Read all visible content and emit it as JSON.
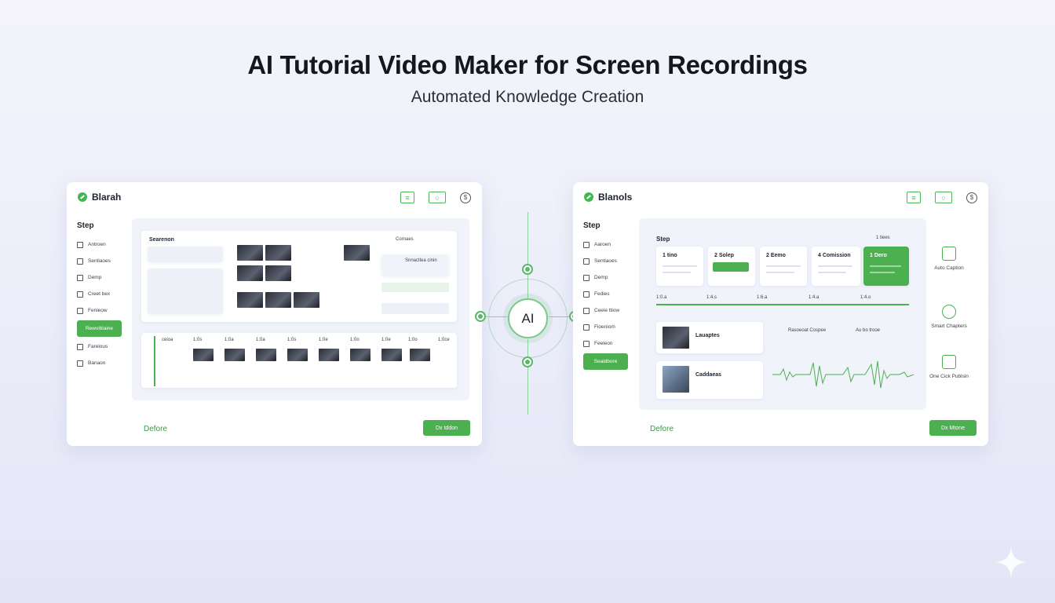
{
  "hero": {
    "title": "AI Tutorial Video Maker for Screen Recordings",
    "subtitle": "Automated Knowledge Creation"
  },
  "colors": {
    "accent": "#4caf50",
    "accent_light": "#8fd19b",
    "background": "#eceefa"
  },
  "left_panel": {
    "brand": "Blarah",
    "sidebar_title": "Step",
    "sidebar": [
      {
        "label": "Antroen",
        "icon": "calendar-icon"
      },
      {
        "label": "Sentiaoes",
        "icon": "grid-icon"
      },
      {
        "label": "Demp",
        "icon": "warning-icon"
      },
      {
        "label": "Creet bex",
        "icon": "doc-icon"
      },
      {
        "label": "Fenieow",
        "icon": "tag-icon"
      },
      {
        "label": "Rewviblaine",
        "icon": "",
        "active": true
      },
      {
        "label": "Farelous",
        "icon": "list-icon"
      },
      {
        "label": "Banaon",
        "icon": "chat-icon"
      }
    ],
    "workspace": {
      "card_title": "Searenon",
      "side_title": "Cornaes",
      "person_title": "Snnactlea cinin",
      "timeline_headers": [
        "ceioa",
        "1:0s",
        "1:0a",
        "1:0a",
        "1:0s",
        "1:0e",
        "1:0o",
        "1:0e",
        "1:0o",
        "1:0ce"
      ]
    },
    "footer_link": "Defore",
    "footer_button": "Dx tddon"
  },
  "right_panel": {
    "brand": "Blanols",
    "sidebar_title": "Step",
    "sidebar": [
      {
        "label": "Aaroen",
        "icon": "calendar-icon"
      },
      {
        "label": "Sentiaoes",
        "icon": "grid-icon"
      },
      {
        "label": "Demp",
        "icon": "warning-icon"
      },
      {
        "label": "Fedies",
        "icon": "diamond-icon"
      },
      {
        "label": "Ceeie ttiow",
        "icon": "doc-icon"
      },
      {
        "label": "Fioeniom",
        "icon": "tag-icon"
      },
      {
        "label": "Feeleon",
        "icon": "list-icon"
      },
      {
        "label": "Seaidbore",
        "icon": "",
        "active": true
      }
    ],
    "workspace": {
      "step_title": "Step",
      "step_meta": "1 tiees",
      "steps": [
        {
          "label": "1 tino"
        },
        {
          "label": "2 Solep",
          "button": ""
        },
        {
          "label": "2 Eemo"
        },
        {
          "label": "4 Comission"
        },
        {
          "label": "1 Dero",
          "active": true
        }
      ],
      "ruler": [
        "1:0.a",
        "1:4.s",
        "1:6.a",
        "1:4.a",
        "1:4.o"
      ],
      "clip_titles": [
        "Lauaptes",
        "Caddaeas"
      ],
      "audio_labels": [
        "Rasoeoat Cospee",
        "Au bo trooe"
      ]
    },
    "features": [
      "Auto Caption",
      "Smart Chapters",
      "One Cick Publsin"
    ],
    "footer_link": "Defore",
    "footer_button": "Dx Mtone"
  },
  "hub": {
    "label": "AI"
  }
}
